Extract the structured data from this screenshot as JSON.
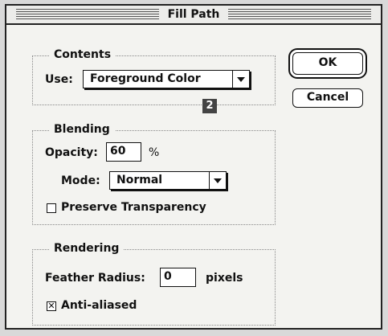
{
  "window": {
    "title": "Fill Path"
  },
  "contents": {
    "group_label": "Contents",
    "use_label": "Use:",
    "use_value": "Foreground Color",
    "badge": "2"
  },
  "blending": {
    "group_label": "Blending",
    "opacity_label": "Opacity:",
    "opacity_value": "60",
    "opacity_unit": "%",
    "mode_label": "Mode:",
    "mode_value": "Normal",
    "preserve_label": "Preserve Transparency",
    "preserve_checked": false
  },
  "rendering": {
    "group_label": "Rendering",
    "feather_label": "Feather Radius:",
    "feather_value": "0",
    "feather_unit": "pixels",
    "antialias_label": "Anti-aliased",
    "antialias_checked": true,
    "check_glyph": "✕"
  },
  "buttons": {
    "ok": "OK",
    "cancel": "Cancel"
  }
}
